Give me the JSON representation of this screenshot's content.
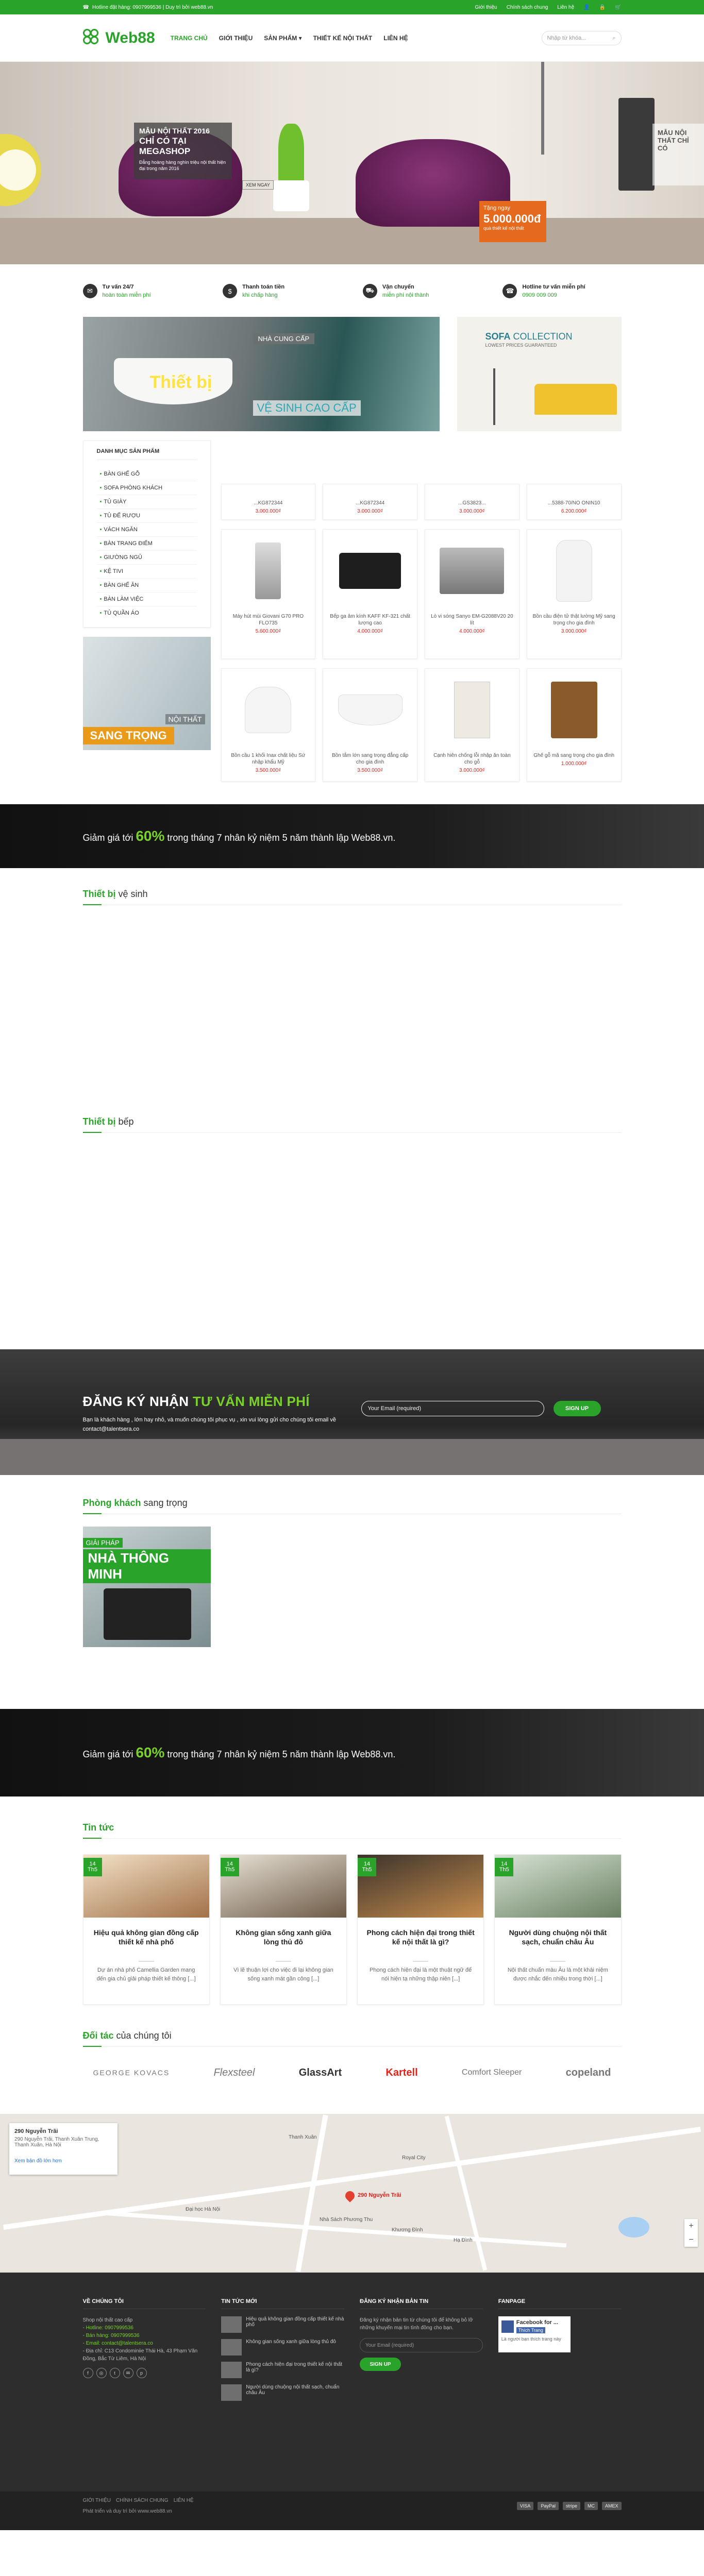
{
  "topbar": {
    "hotline": "Hotline đặt hàng: 0907999536 | Duy trì bởi web88.vn",
    "links": [
      "Giới thiệu",
      "Chính sách chung",
      "Liên hệ"
    ]
  },
  "header": {
    "logo": "Web88",
    "nav": [
      "TRANG CHỦ",
      "GIỚI THIỆU",
      "SẢN PHẨM ▾",
      "THIẾT KẾ NỘI THẤT",
      "LIÊN HỆ"
    ],
    "search_placeholder": "Nhập từ khóa..."
  },
  "hero": {
    "l1": "MẪU NỘI THẤT 2016",
    "l2": "CHỈ CÓ TẠI MEGASHOP",
    "l3": "Đẳng hoàng hàng nghìn triệu nội thất hiện đại trong năm 2016",
    "gift_l1": "Tặng ngay",
    "gift_l2": "5.000.000đ",
    "gift_l3": "quà thiết kế nội thất",
    "side": "MẪU NỘI THẤT CHỈ CÓ",
    "more": "XEM NGAY"
  },
  "features": [
    {
      "title": "Tư vấn 24/7",
      "sub": "hoàn toàn miễn phí"
    },
    {
      "title": "Thanh toán tiền",
      "sub": "khi chấp hàng"
    },
    {
      "title": "Vận chuyển",
      "sub": "miễn phí nội thành"
    },
    {
      "title": "Hotline tư vấn miễn phí",
      "sub": "0909 009 009"
    }
  ],
  "banners": {
    "ncc": "NHÀ CUNG CẤP",
    "tb": "Thiết bị",
    "vs": "VỆ SINH CAO CẤP",
    "sofa1": "SOFA",
    "sofa2": "COLLECTION",
    "sofa3": "LOWEST PRICES GUARANTEED"
  },
  "categories": {
    "heading": "DANH MỤC SẢN PHẨM",
    "items": [
      "BÀN GHẾ GỖ",
      "SOFA PHÒNG KHÁCH",
      "TỦ GIÀY",
      "TỦ ĐỂ RƯỢU",
      "VÁCH NGĂN",
      "BÀN TRANG ĐIỂM",
      "GIƯỜNG NGỦ",
      "KỆ TIVI",
      "BÀN GHẾ ĂN",
      "BÀN LÀM VIỆC",
      "TỦ QUẦN ÁO"
    ]
  },
  "noi_that": {
    "a": "NỘI THẤT",
    "b": "SANG TRỌNG"
  },
  "products_row1": [
    {
      "name": "...KG872344",
      "price": "3.000.000₫"
    },
    {
      "name": "...KG872344",
      "price": "3.000.000₫"
    },
    {
      "name": "...GS3823...",
      "price": "3.000.000₫"
    },
    {
      "name": "...5388-70/NO ONIN10",
      "price": "6.200.000₫"
    }
  ],
  "products_row2": [
    {
      "name": "Máy hút mùi Giovani G70 PRO FLO735",
      "price": "5.600.000₫"
    },
    {
      "name": "Bếp ga âm kính KAFF KF-321 chất lượng cao",
      "price": "4.000.000₫"
    },
    {
      "name": "Lò vi sóng Sanyo EM-G2088V20 20 lít",
      "price": "4.000.000₫"
    },
    {
      "name": "Bồn cầu điện tử thật lường Mỹ sang trọng cho gia đình",
      "price": "3.000.000₫"
    }
  ],
  "products_row3": [
    {
      "name": "Bồn cầu 1 khối Inax chất liệu Sứ nhập khẩu Mỹ",
      "price": "3.500.000₫"
    },
    {
      "name": "Bồn tắm lớn sang trọng đẳng cấp cho gia đình",
      "price": "3.500.000₫"
    },
    {
      "name": "Cạnh hiên chống lỗi nhập ăn toàn cho gỗ",
      "price": "3.000.000₫"
    },
    {
      "name": "Ghế gỗ mã sang trọng cho gia đình",
      "price": "1.000.000₫"
    }
  ],
  "promo": {
    "pre": "Giảm giá tới",
    "pct": "60%",
    "post": "trong tháng 7 nhân kỷ niệm 5 năm thành lập Web88.vn."
  },
  "sec_vs": {
    "b": "Thiết bị",
    "t": "vệ sinh"
  },
  "sec_bep": {
    "b": "Thiết bị",
    "t": "bếp"
  },
  "subscribe": {
    "h1": "ĐĂNG KÝ NHẬN",
    "h2": "TƯ VẤN MIỄN PHÍ",
    "p": "Bạn là khách hàng , lớn hay nhỏ, và muốn chúng tôi phục vụ , xin vui lòng gửi cho chúng tôi email về contact@talentsera.co",
    "placeholder": "Your Email (required)",
    "btn": "SIGN UP"
  },
  "sec_pk": {
    "b": "Phòng khách",
    "t": "sang trọng"
  },
  "smart": {
    "a": "GIẢI PHÁP",
    "b": "NHÀ THÔNG MINH"
  },
  "sec_news": {
    "b": "Tin tức",
    "t": ""
  },
  "news": [
    {
      "d": "14",
      "m": "Th5",
      "title": "Hiệu quả không gian đồng cấp thiết kế nhà phố",
      "ex": "Dự án nhà phố Camellia Garden mang đến gia chủ giải pháp thiết kế thông [...]"
    },
    {
      "d": "14",
      "m": "Th5",
      "title": "Không gian sống xanh giữa lòng thủ đô",
      "ex": "Vì lẽ thuận lợi cho việc đi lại không gian sống xanh mát gần công [...]"
    },
    {
      "d": "14",
      "m": "Th5",
      "title": "Phong cách hiện đại trong thiết kế nội thất là gì?",
      "ex": "Phong cách hiện đại là một thuật ngữ để nói hiện tạ những thập niên [...]"
    },
    {
      "d": "14",
      "m": "Th5",
      "title": "Người dùng chuộng nội thất sạch, chuẩn châu Âu",
      "ex": "Nội thất chuẩn màu Âu là một khái niệm được nhắc đến nhiều trong thời [...]"
    }
  ],
  "sec_partner": {
    "b": "Đối tác",
    "t": "của chúng tôi"
  },
  "partners": [
    "GEORGE KOVACS",
    "Flexsteel",
    "GlassArt",
    "Kartell",
    "Comfort Sleeper",
    "copeland"
  ],
  "map": {
    "addr": "290 Nguyễn Trãi",
    "addr2": "290 Nguyễn Trãi, Thanh Xuân Trung, Thanh Xuân, Hà Nội",
    "larger": "Xem bản đồ lớn hơn",
    "pin": "290 Nguyễn Trãi",
    "labels": [
      "Thanh Xuân",
      "Nhà Sách Phương Thu",
      "Royal City",
      "Hạ Đình",
      "Khương Đình",
      "Đại học Hà Nội"
    ]
  },
  "footer": {
    "c1_h": "VỀ CHÚNG TÔI",
    "c1_p1": "Shop nội thất cao cấp",
    "c1_hotline": "- Hotline: 0907999536",
    "c1_tel": "- Bán hàng: 0907999536",
    "c1_email": "- Email: contact@talentsera.co",
    "c1_addr": "- Địa chỉ: C13 Condominiie Thái Hà, 43 Phạm Văn Đồng, Bắc Từ Liêm, Hà Nội",
    "c2_h": "TIN TỨC MỚI",
    "posts": [
      "Hiệu quả không gian đồng cấp thiết kế nhà phố",
      "Không gian sống xanh giữa lòng thủ đô",
      "Phong cách hiện đại trong thiết kế nội thất là gì?",
      "Người dùng chuộng nội thất sạch, chuẩn châu Âu"
    ],
    "c3_h": "ĐĂNG KÝ NHẬN BẢN TIN",
    "c3_p": "Đăng ký nhận bản tin từ chúng tôi để không bỏ lỡ những khuyến mại tin tình đồng cho bạn.",
    "c3_ph": "Your Email (required)",
    "c3_btn": "SIGN UP",
    "c4_h": "FANPAGE",
    "fb_name": "Facebook for ...",
    "fb_like": "Thích Trang",
    "fb_cap": "Là người bạn thích trang này"
  },
  "bottom": {
    "links": [
      "GIỚI THIỆU",
      "CHÍNH SÁCH CHUNG",
      "LIÊN HỆ"
    ],
    "copy": "Phát triển và duy trì bởi www.web88.vn",
    "pay": [
      "VISA",
      "PayPal",
      "stripe",
      "MC",
      "AMEX"
    ]
  }
}
